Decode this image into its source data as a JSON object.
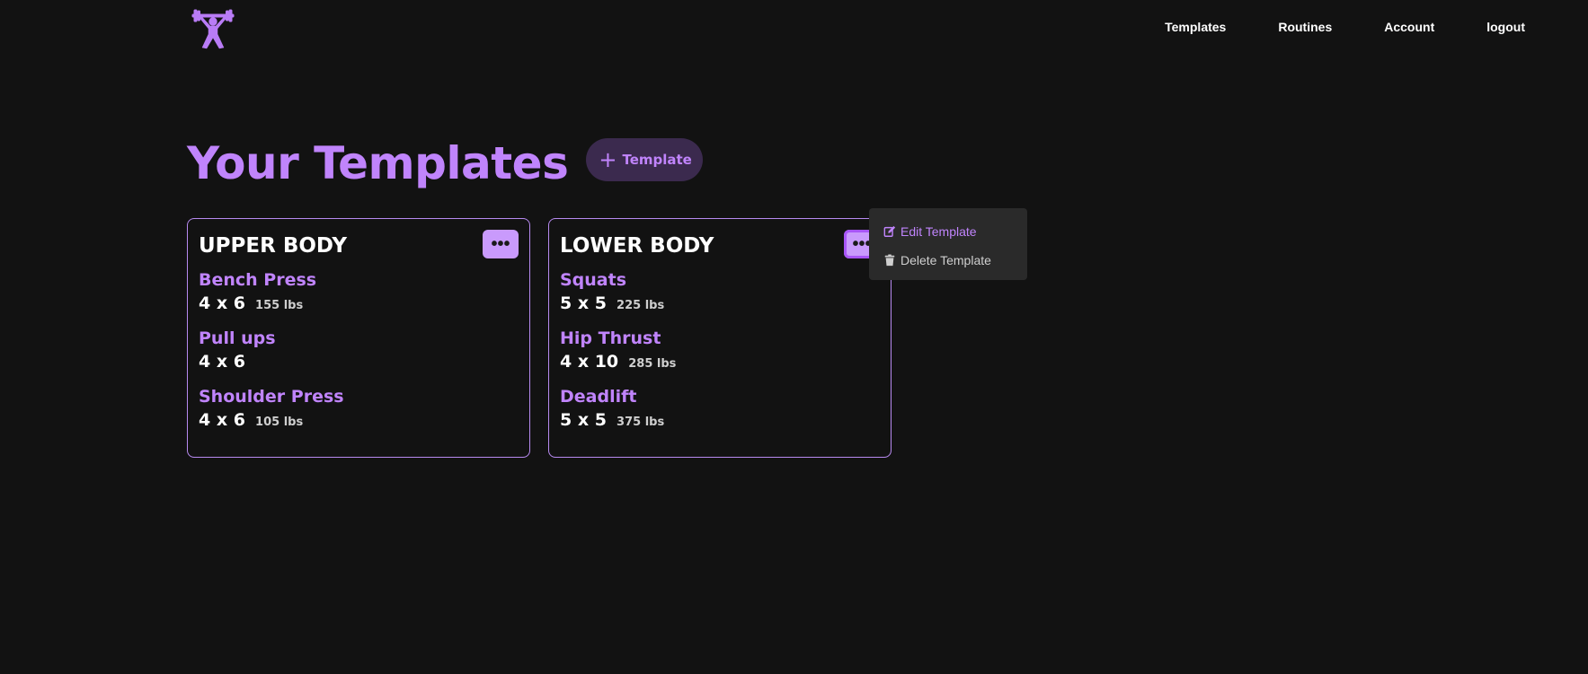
{
  "nav": {
    "logo_icon": "weightlifter-icon",
    "links": [
      "Templates",
      "Routines",
      "Account",
      "logout"
    ]
  },
  "header": {
    "title": "Your Templates",
    "add_button_label": "Template"
  },
  "templates": [
    {
      "title": "UPPER BODY",
      "exercises": [
        {
          "name": "Bench Press",
          "sets": "4 x 6",
          "weight": "155 lbs"
        },
        {
          "name": "Pull ups",
          "sets": "4 x 6",
          "weight": ""
        },
        {
          "name": "Shoulder Press",
          "sets": "4 x 6",
          "weight": "105 lbs"
        }
      ]
    },
    {
      "title": "LOWER BODY",
      "exercises": [
        {
          "name": "Squats",
          "sets": "5 x 5",
          "weight": "225 lbs"
        },
        {
          "name": "Hip Thrust",
          "sets": "4 x 10",
          "weight": "285 lbs"
        },
        {
          "name": "Deadlift",
          "sets": "5 x 5",
          "weight": "375 lbs"
        }
      ]
    }
  ],
  "dropdown": {
    "edit_label": "Edit Template",
    "delete_label": "Delete Template"
  },
  "colors": {
    "background": "#121212",
    "accent": "#c084fc",
    "card_border": "#b78af0",
    "menu_button": "#c99afc",
    "dropdown_bg": "#2a2a2a"
  }
}
